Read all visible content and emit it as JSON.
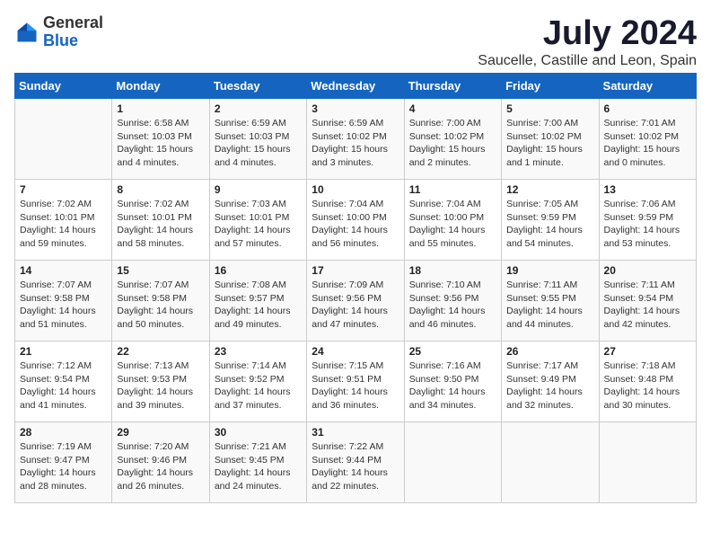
{
  "header": {
    "logo_general": "General",
    "logo_blue": "Blue",
    "title": "July 2024",
    "subtitle": "Saucelle, Castille and Leon, Spain"
  },
  "weekdays": [
    "Sunday",
    "Monday",
    "Tuesday",
    "Wednesday",
    "Thursday",
    "Friday",
    "Saturday"
  ],
  "weeks": [
    [
      {
        "day": "",
        "info": ""
      },
      {
        "day": "1",
        "info": "Sunrise: 6:58 AM\nSunset: 10:03 PM\nDaylight: 15 hours\nand 4 minutes."
      },
      {
        "day": "2",
        "info": "Sunrise: 6:59 AM\nSunset: 10:03 PM\nDaylight: 15 hours\nand 4 minutes."
      },
      {
        "day": "3",
        "info": "Sunrise: 6:59 AM\nSunset: 10:02 PM\nDaylight: 15 hours\nand 3 minutes."
      },
      {
        "day": "4",
        "info": "Sunrise: 7:00 AM\nSunset: 10:02 PM\nDaylight: 15 hours\nand 2 minutes."
      },
      {
        "day": "5",
        "info": "Sunrise: 7:00 AM\nSunset: 10:02 PM\nDaylight: 15 hours\nand 1 minute."
      },
      {
        "day": "6",
        "info": "Sunrise: 7:01 AM\nSunset: 10:02 PM\nDaylight: 15 hours\nand 0 minutes."
      }
    ],
    [
      {
        "day": "7",
        "info": "Sunrise: 7:02 AM\nSunset: 10:01 PM\nDaylight: 14 hours\nand 59 minutes."
      },
      {
        "day": "8",
        "info": "Sunrise: 7:02 AM\nSunset: 10:01 PM\nDaylight: 14 hours\nand 58 minutes."
      },
      {
        "day": "9",
        "info": "Sunrise: 7:03 AM\nSunset: 10:01 PM\nDaylight: 14 hours\nand 57 minutes."
      },
      {
        "day": "10",
        "info": "Sunrise: 7:04 AM\nSunset: 10:00 PM\nDaylight: 14 hours\nand 56 minutes."
      },
      {
        "day": "11",
        "info": "Sunrise: 7:04 AM\nSunset: 10:00 PM\nDaylight: 14 hours\nand 55 minutes."
      },
      {
        "day": "12",
        "info": "Sunrise: 7:05 AM\nSunset: 9:59 PM\nDaylight: 14 hours\nand 54 minutes."
      },
      {
        "day": "13",
        "info": "Sunrise: 7:06 AM\nSunset: 9:59 PM\nDaylight: 14 hours\nand 53 minutes."
      }
    ],
    [
      {
        "day": "14",
        "info": "Sunrise: 7:07 AM\nSunset: 9:58 PM\nDaylight: 14 hours\nand 51 minutes."
      },
      {
        "day": "15",
        "info": "Sunrise: 7:07 AM\nSunset: 9:58 PM\nDaylight: 14 hours\nand 50 minutes."
      },
      {
        "day": "16",
        "info": "Sunrise: 7:08 AM\nSunset: 9:57 PM\nDaylight: 14 hours\nand 49 minutes."
      },
      {
        "day": "17",
        "info": "Sunrise: 7:09 AM\nSunset: 9:56 PM\nDaylight: 14 hours\nand 47 minutes."
      },
      {
        "day": "18",
        "info": "Sunrise: 7:10 AM\nSunset: 9:56 PM\nDaylight: 14 hours\nand 46 minutes."
      },
      {
        "day": "19",
        "info": "Sunrise: 7:11 AM\nSunset: 9:55 PM\nDaylight: 14 hours\nand 44 minutes."
      },
      {
        "day": "20",
        "info": "Sunrise: 7:11 AM\nSunset: 9:54 PM\nDaylight: 14 hours\nand 42 minutes."
      }
    ],
    [
      {
        "day": "21",
        "info": "Sunrise: 7:12 AM\nSunset: 9:54 PM\nDaylight: 14 hours\nand 41 minutes."
      },
      {
        "day": "22",
        "info": "Sunrise: 7:13 AM\nSunset: 9:53 PM\nDaylight: 14 hours\nand 39 minutes."
      },
      {
        "day": "23",
        "info": "Sunrise: 7:14 AM\nSunset: 9:52 PM\nDaylight: 14 hours\nand 37 minutes."
      },
      {
        "day": "24",
        "info": "Sunrise: 7:15 AM\nSunset: 9:51 PM\nDaylight: 14 hours\nand 36 minutes."
      },
      {
        "day": "25",
        "info": "Sunrise: 7:16 AM\nSunset: 9:50 PM\nDaylight: 14 hours\nand 34 minutes."
      },
      {
        "day": "26",
        "info": "Sunrise: 7:17 AM\nSunset: 9:49 PM\nDaylight: 14 hours\nand 32 minutes."
      },
      {
        "day": "27",
        "info": "Sunrise: 7:18 AM\nSunset: 9:48 PM\nDaylight: 14 hours\nand 30 minutes."
      }
    ],
    [
      {
        "day": "28",
        "info": "Sunrise: 7:19 AM\nSunset: 9:47 PM\nDaylight: 14 hours\nand 28 minutes."
      },
      {
        "day": "29",
        "info": "Sunrise: 7:20 AM\nSunset: 9:46 PM\nDaylight: 14 hours\nand 26 minutes."
      },
      {
        "day": "30",
        "info": "Sunrise: 7:21 AM\nSunset: 9:45 PM\nDaylight: 14 hours\nand 24 minutes."
      },
      {
        "day": "31",
        "info": "Sunrise: 7:22 AM\nSunset: 9:44 PM\nDaylight: 14 hours\nand 22 minutes."
      },
      {
        "day": "",
        "info": ""
      },
      {
        "day": "",
        "info": ""
      },
      {
        "day": "",
        "info": ""
      }
    ]
  ]
}
